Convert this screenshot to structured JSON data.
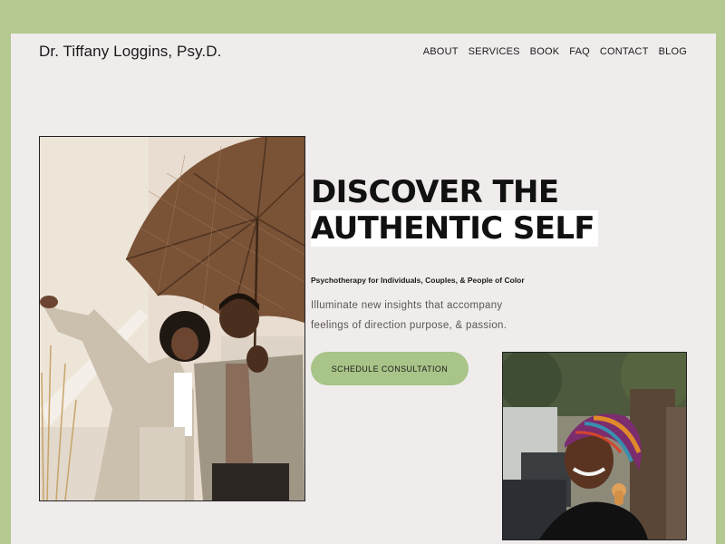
{
  "brand": {
    "name": "Dr. Tiffany Loggins, Psy.D."
  },
  "nav": {
    "items": [
      {
        "label": "ABOUT"
      },
      {
        "label": "SERVICES"
      },
      {
        "label": "BOOK"
      },
      {
        "label": "FAQ"
      },
      {
        "label": "CONTACT"
      },
      {
        "label": "BLOG"
      }
    ]
  },
  "hero": {
    "headline_line1": "DISCOVER THE",
    "headline_line2": "AUTHENTIC SELF",
    "subhead": "Psychotherapy for Individuals, Couples, & People of Color",
    "body_line1": "Illuminate new insights that accompany",
    "body_line2": "feelings of direction purpose, & passion.",
    "cta_label": "SCHEDULE CONSULTATION"
  },
  "colors": {
    "frame_green": "#b3c98f",
    "page_background": "#f0ecec",
    "cta_green": "#a8c488"
  },
  "icons": {
    "main_photo": "photo-couple-umbrella",
    "side_photo": "photo-woman-headwrap"
  }
}
